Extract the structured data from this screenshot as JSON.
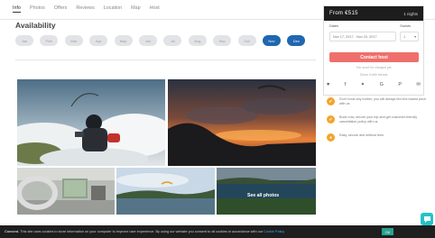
{
  "nav": {
    "tabs": [
      "Info",
      "Photos",
      "Offers",
      "Reviews",
      "Location",
      "Map",
      "Host"
    ]
  },
  "availability": {
    "title": "Availability",
    "months": [
      {
        "label": "Jan",
        "selected": false
      },
      {
        "label": "Feb",
        "selected": false
      },
      {
        "label": "Mar",
        "selected": false
      },
      {
        "label": "Apr",
        "selected": false
      },
      {
        "label": "May",
        "selected": false
      },
      {
        "label": "Jun",
        "selected": false
      },
      {
        "label": "Jul",
        "selected": false
      },
      {
        "label": "Aug",
        "selected": false
      },
      {
        "label": "Sep",
        "selected": false
      },
      {
        "label": "Oct",
        "selected": false
      },
      {
        "label": "Nov",
        "selected": true
      },
      {
        "label": "Dec",
        "selected": true
      }
    ]
  },
  "gallery": {
    "see_all_label": "See all photos"
  },
  "booking": {
    "price": "From €515",
    "nights": "1 nights",
    "dates_label": "Dates",
    "dates_value": "Nov 17, 2017 - Nov 20, 2017",
    "guests_label": "Guests",
    "guests_value": "1",
    "contact_label": "Contact host",
    "note_1": "You won't be charged yet",
    "note_2": "Share it with friends"
  },
  "features": [
    {
      "icon": "thumbs-up-icon",
      "text": "Don't book any further, you will always find the lowest price with us"
    },
    {
      "icon": "thumbs-up-icon",
      "text": "Book now, secure your trip and get customer-friendly cancellation policy with us"
    },
    {
      "icon": "chat-icon",
      "text": "Easy, secure and without fees"
    }
  ],
  "cookie": {
    "bold": "Consent.",
    "text": " This site uses cookies to store information on your computer to improve user experience. By using our website you consent to all cookies in accordance with our ",
    "link": "Cookie Policy",
    "ok": "OK"
  },
  "colors": {
    "accent_blue": "#1f67b0",
    "contact_red": "#ef6f6c",
    "feature_orange": "#f3a42c",
    "chat_teal": "#23c3c9"
  }
}
